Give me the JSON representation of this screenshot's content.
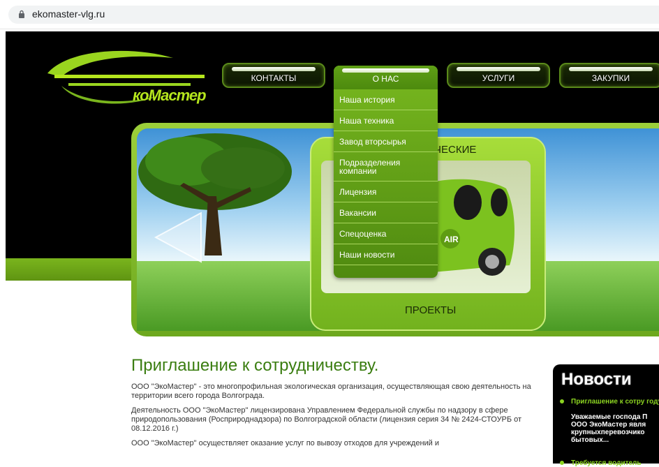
{
  "browser": {
    "url": "ekomaster-vlg.ru"
  },
  "logo": {
    "text": "коМастер"
  },
  "nav": [
    {
      "label": "КОНТАКТЫ"
    },
    {
      "label": "О НАС"
    },
    {
      "label": "УСЛУГИ"
    },
    {
      "label": "ЗАКУПКИ"
    }
  ],
  "dropdown": {
    "items": [
      "Наша история",
      "Наша техника",
      "Завод вторсырья",
      "Подразделения компании",
      "Лицензия",
      "Вакансии",
      "Спецоценка",
      "Наши новости"
    ]
  },
  "banner": {
    "title_top": "ЧЕСКИЕ",
    "title_bottom": "ПРОЕКТЫ",
    "car_label": "AIR"
  },
  "main": {
    "heading": "Приглашение к сотрудничеству.",
    "paragraphs": [
      "ООО \"ЭкоМастер\" - это многопрофильная экологическая организация, осуществляющая свою деятельность на территории всего города Волгограда.",
      "Деятельность ООО \"ЭкоМастер\" лицензирована Управлением Федеральной службы по надзору в сфере природопользования (Росприроднадзора) по Волгоградской области  (лицензия серия 34 № 2424-СТОУРБ от 08.12.2016 г.)",
      "ООО \"ЭкоМастер\" осуществляет оказание услуг по вывозу отходов для учреждений и"
    ]
  },
  "news": {
    "title": "Новости",
    "item_link": "Приглашение к сотру году.",
    "item_body": "Уважаемые господа П ООО ЭкоМастер явля крупныхперевозчико бытовых...",
    "next": "Требуется водитель"
  },
  "colors": {
    "accent": "#7ab51d",
    "header_bg": "#000000",
    "heading": "#3a7d10"
  }
}
